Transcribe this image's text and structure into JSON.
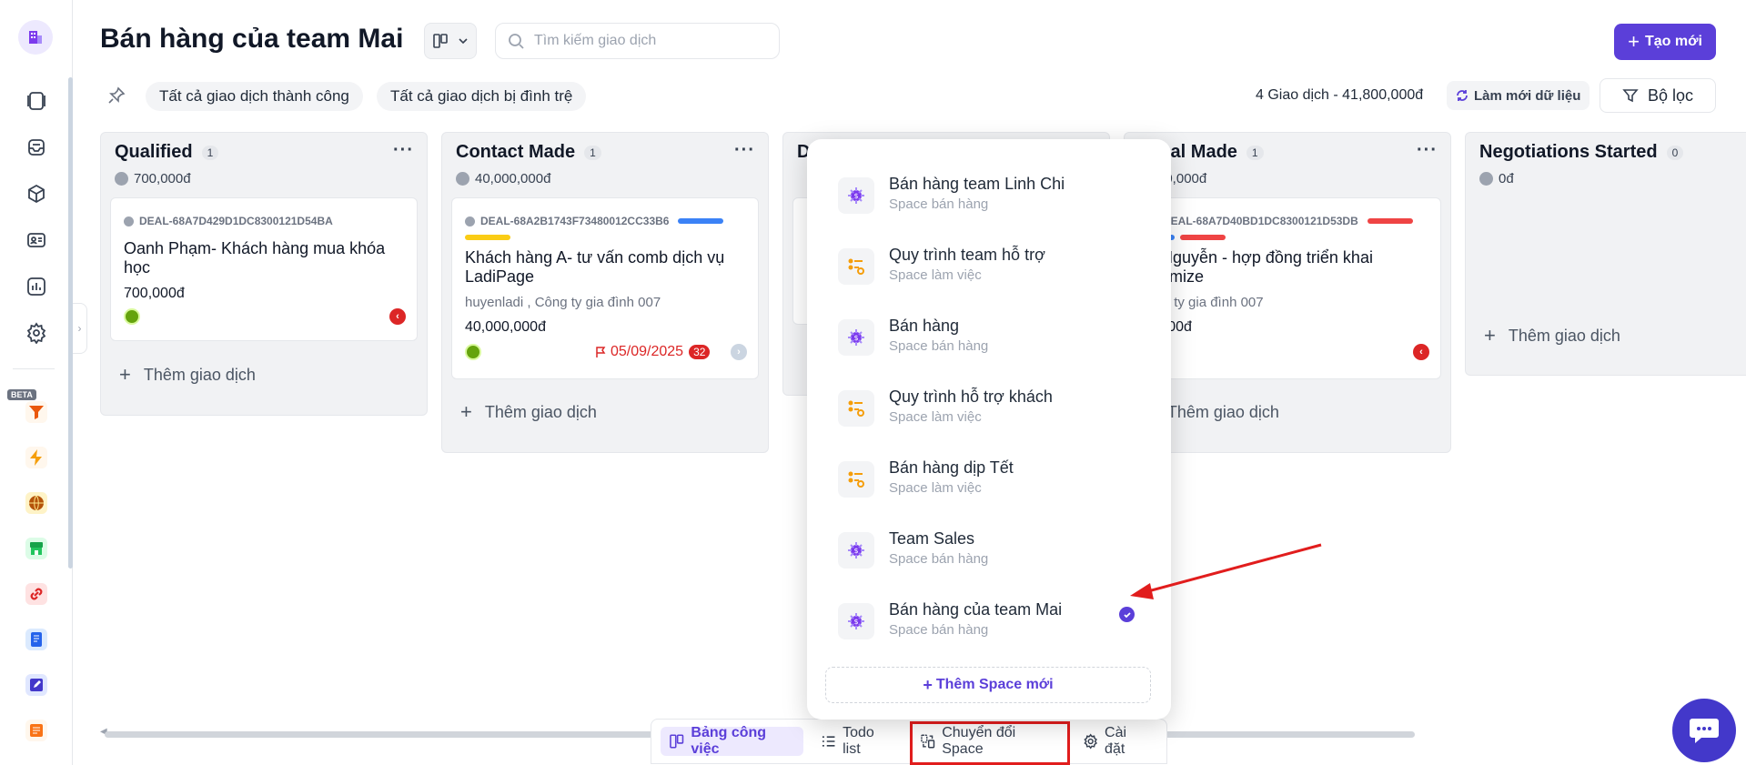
{
  "header": {
    "title": "Bán hàng của team Mai",
    "search_placeholder": "Tìm kiếm giao dịch",
    "create_label": "Tạo mới"
  },
  "filters": {
    "chip_success": "Tất cả giao dịch thành công",
    "chip_stalled": "Tất cả giao dịch bị đình trệ",
    "summary": "4 Giao dịch - 41,800,000đ",
    "refresh_label": "Làm mới dữ liệu",
    "filter_label": "Bộ lọc"
  },
  "rail": {
    "beta": "BETA"
  },
  "columns": [
    {
      "name": "Qualified",
      "count": "1",
      "total": "700,000đ",
      "add_label": "Thêm giao dịch",
      "card": {
        "deal_id": "DEAL-68A7D429D1DC8300121D54BA",
        "title": "Oanh Phạm- Khách hàng mua khóa học",
        "amount": "700,000đ"
      }
    },
    {
      "name": "Contact Made",
      "count": "1",
      "total": "40,000,000đ",
      "add_label": "Thêm giao dịch",
      "card": {
        "deal_id": "DEAL-68A2B1743F73480012CC33B6",
        "title": "Khách hàng A- tư vấn comb dịch vụ LadiPage",
        "sub": "huyenladi , Công ty gia đình 007",
        "amount": "40,000,000đ",
        "due": "05/09/2025",
        "overdue": "32"
      }
    },
    {
      "name": "D",
      "count": "",
      "total": "",
      "add_label": ""
    },
    {
      "name": "posal Made",
      "count": "1",
      "total": "00,000đ",
      "add_label": "Thêm giao dịch",
      "card": {
        "deal_id": "DEAL-68A7D40BD1DC8300121D53DB",
        "title": "h Nguyễn - hợp đồng triển khai stomize",
        "sub": "ông ty gia đình 007",
        "amount": "0,000đ"
      }
    },
    {
      "name": "Negotiations Started",
      "count": "0",
      "total": "0đ",
      "add_label": "Thêm giao dịch"
    }
  ],
  "spaces": [
    {
      "name": "Bán hàng team Linh Chi",
      "type": "Space bán hàng",
      "icon": "sales-space-icon"
    },
    {
      "name": "Quy trình team hỗ trợ",
      "type": "Space làm việc",
      "icon": "workflow-space-icon"
    },
    {
      "name": "Bán hàng",
      "type": "Space bán hàng",
      "icon": "sales-space-icon"
    },
    {
      "name": "Quy trình hỗ trợ khách",
      "type": "Space làm việc",
      "icon": "workflow-space-icon"
    },
    {
      "name": "Bán hàng dịp Tết",
      "type": "Space làm việc",
      "icon": "workflow-space-icon"
    },
    {
      "name": "Team Sales",
      "type": "Space bán hàng",
      "icon": "sales-space-icon"
    },
    {
      "name": "Bán hàng của team Mai",
      "type": "Space bán hàng",
      "icon": "sales-space-icon",
      "selected": true
    }
  ],
  "add_space_label": "Thêm Space mới",
  "toolbar": {
    "board": "Bảng công việc",
    "todo": "Todo list",
    "switch_space": "Chuyển đổi Space",
    "settings": "Cài đặt"
  },
  "colors": {
    "accent": "#5b3fd9",
    "highlight": "#e11d1d",
    "overdue": "#dc2626"
  }
}
